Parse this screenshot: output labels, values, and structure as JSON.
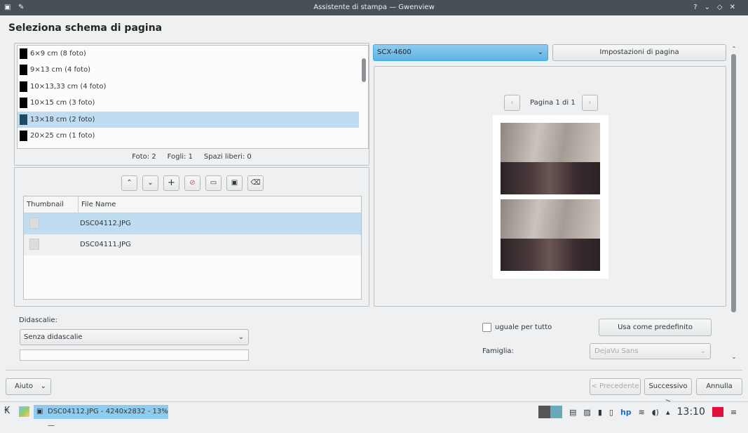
{
  "window": {
    "title": "Assistente di stampa — Gwenview",
    "heading": "Seleziona schema di pagina"
  },
  "layouts": [
    {
      "label": "6×9 cm (8 foto)"
    },
    {
      "label": "9×13 cm (4 foto)"
    },
    {
      "label": "10×13,33 cm (4 foto)"
    },
    {
      "label": "10×15 cm (3 foto)"
    },
    {
      "label": "13×18 cm (2 foto)",
      "selected": true
    },
    {
      "label": "20×25 cm (1 foto)"
    }
  ],
  "stats": {
    "photos_label": "Foto:",
    "photos": "2",
    "sheets_label": "Fogli:",
    "sheets": "1",
    "free_label": "Spazi liberi:",
    "free": "0"
  },
  "table": {
    "headers": [
      "Thumbnail",
      "File Name"
    ],
    "rows": [
      {
        "file": "DSC04112.JPG",
        "selected": true
      },
      {
        "file": "DSC04111.JPG"
      }
    ]
  },
  "printer": {
    "selected": "SCX-4600",
    "page_setup": "Impostazioni di pagina"
  },
  "preview": {
    "page": "Pagina 1 di 1"
  },
  "captions": {
    "label": "Didascalie:",
    "selected": "Senza didascalie",
    "same_for_all": "uguale per tutto",
    "use_default": "Usa come predefinito",
    "family_label": "Famiglia:",
    "family": "DejaVu Sans"
  },
  "footer": {
    "help": "Aiuto",
    "prev": "< Precedente",
    "next": "Successivo >",
    "cancel": "Annulla"
  },
  "taskbar": {
    "task": "DSC04112.JPG - 4240x2832 - 13% —",
    "clock": "13:10"
  }
}
